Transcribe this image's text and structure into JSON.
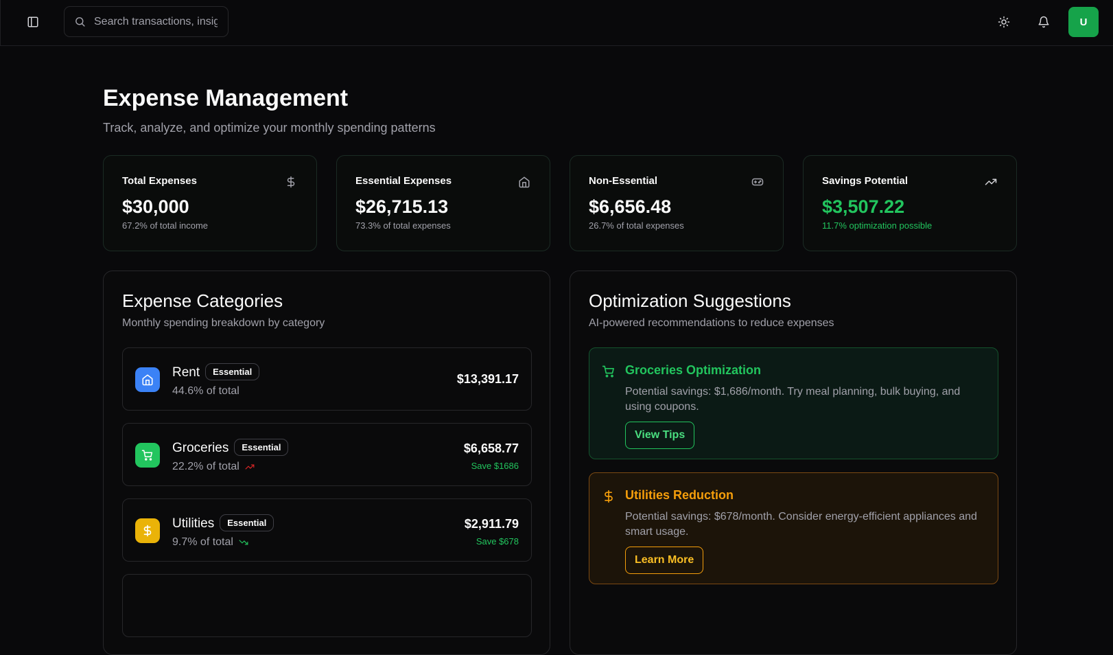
{
  "header": {
    "search_placeholder": "Search transactions, insights...",
    "avatar_initial": "U"
  },
  "page": {
    "title": "Expense Management",
    "subtitle": "Track, analyze, and optimize your monthly spending patterns"
  },
  "stats": [
    {
      "label": "Total Expenses",
      "value": "$30,000",
      "note": "67.2% of total income",
      "icon": "dollar-icon"
    },
    {
      "label": "Essential Expenses",
      "value": "$26,715.13",
      "note": "73.3% of total expenses",
      "icon": "home-icon"
    },
    {
      "label": "Non-Essential",
      "value": "$6,656.48",
      "note": "26.7% of total expenses",
      "icon": "gamepad-icon"
    },
    {
      "label": "Savings Potential",
      "value": "$3,507.22",
      "note": "11.7% optimization possible",
      "icon": "trending-up-icon"
    }
  ],
  "categories_panel": {
    "title": "Expense Categories",
    "subtitle": "Monthly spending breakdown by category",
    "items": [
      {
        "name": "Rent",
        "badge": "Essential",
        "pct": "44.6% of total",
        "amount": "$13,391.17",
        "save": "",
        "color": "#3b82f6",
        "icon": "home-icon",
        "trend": ""
      },
      {
        "name": "Groceries",
        "badge": "Essential",
        "pct": "22.2% of total",
        "amount": "$6,658.77",
        "save": "Save $1686",
        "color": "#22c55e",
        "icon": "cart-icon",
        "trend": "up"
      },
      {
        "name": "Utilities",
        "badge": "Essential",
        "pct": "9.7% of total",
        "amount": "$2,911.79",
        "save": "Save $678",
        "color": "#eab308",
        "icon": "dollar-icon",
        "trend": "down"
      }
    ]
  },
  "suggestions_panel": {
    "title": "Optimization Suggestions",
    "subtitle": "AI-powered recommendations to reduce expenses",
    "items": [
      {
        "title": "Groceries Optimization",
        "desc": "Potential savings: $1,686/month. Try meal planning, bulk buying, and using coupons.",
        "button": "View Tips",
        "icon": "cart-icon"
      },
      {
        "title": "Utilities Reduction",
        "desc": "Potential savings: $678/month. Consider energy-efficient appliances and smart usage.",
        "button": "Learn More",
        "icon": "dollar-icon"
      }
    ]
  }
}
